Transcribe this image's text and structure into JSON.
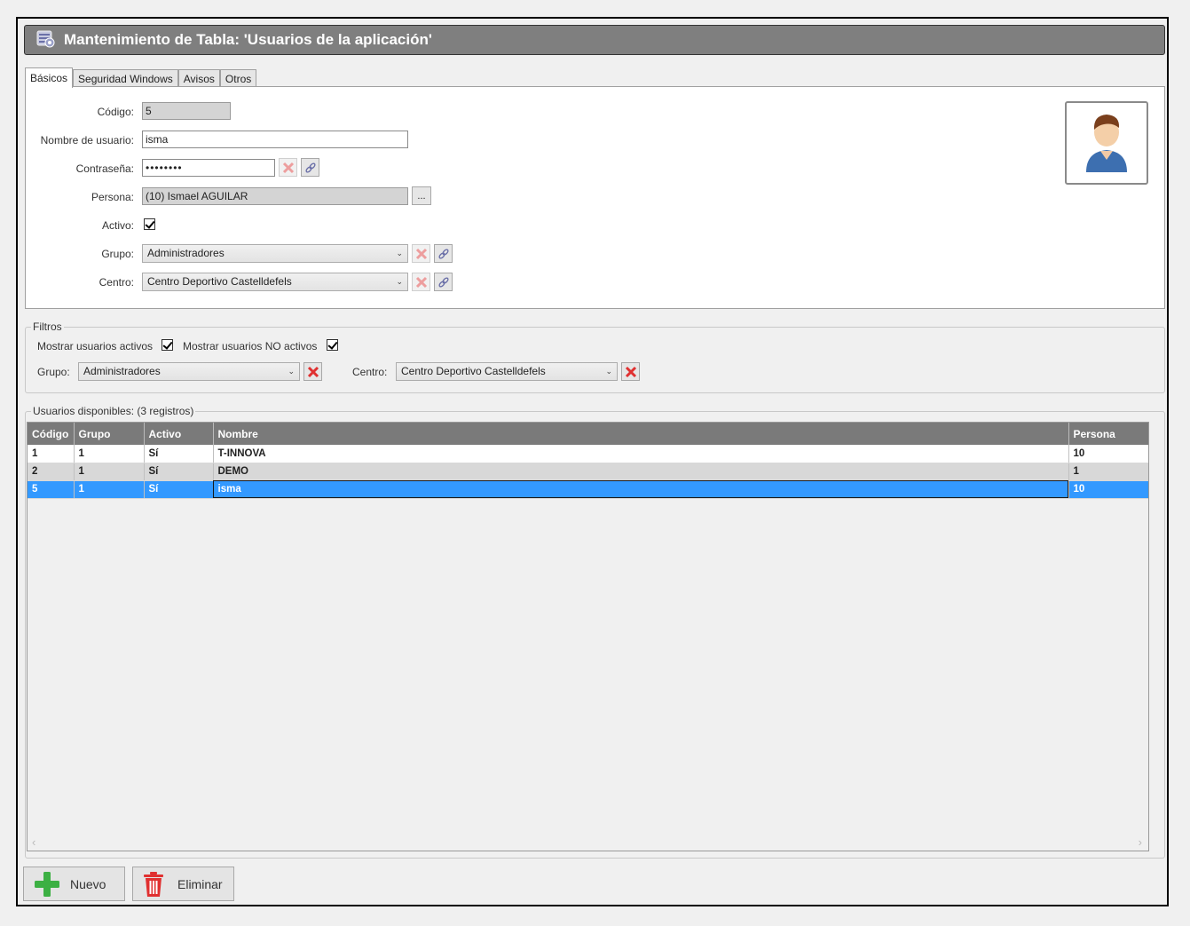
{
  "window": {
    "title": "Mantenimiento de Tabla: 'Usuarios de la aplicación'"
  },
  "tabs": [
    {
      "label": "Básicos",
      "active": true
    },
    {
      "label": "Seguridad Windows"
    },
    {
      "label": "Avisos"
    },
    {
      "label": "Otros"
    }
  ],
  "form": {
    "codigo_label": "Código:",
    "codigo_value": "5",
    "nombre_label": "Nombre de usuario:",
    "nombre_value": "isma",
    "password_label": "Contraseña:",
    "password_value": "••••••••",
    "persona_label": "Persona:",
    "persona_value": "(10) Ismael AGUILAR",
    "persona_button": "...",
    "activo_label": "Activo:",
    "activo_checked": true,
    "grupo_label": "Grupo:",
    "grupo_value": "Administradores",
    "centro_label": "Centro:",
    "centro_value": "Centro Deportivo Castelldefels"
  },
  "filters": {
    "legend": "Filtros",
    "show_active_label": "Mostrar usuarios activos",
    "show_inactive_label": "Mostrar usuarios NO activos",
    "grupo_label": "Grupo:",
    "grupo_value": "Administradores",
    "centro_label": "Centro:",
    "centro_value": "Centro Deportivo Castelldefels"
  },
  "users": {
    "legend": "Usuarios disponibles:  (3 registros)",
    "columns": [
      "Código",
      "Grupo",
      "Activo",
      "Nombre",
      "Persona"
    ],
    "rows": [
      {
        "codigo": "1",
        "grupo": "1",
        "activo": "Sí",
        "nombre": "T-INNOVA",
        "persona": "10"
      },
      {
        "codigo": "2",
        "grupo": "1",
        "activo": "Sí",
        "nombre": "DEMO",
        "persona": "1"
      },
      {
        "codigo": "5",
        "grupo": "1",
        "activo": "Sí",
        "nombre": "isma",
        "persona": "10"
      }
    ],
    "selected_row": 2
  },
  "actions": {
    "new_label": "Nuevo",
    "delete_label": "Eliminar"
  },
  "colors": {
    "title_bg": "#7f7f7f",
    "selection": "#3399ff",
    "grid_header": "#7a7a7a",
    "delete_red": "#e03030",
    "add_green": "#3cb043"
  },
  "icons": [
    "table-settings-icon",
    "user-avatar-icon",
    "clear-x-icon",
    "link-icon",
    "plus-icon",
    "trash-icon"
  ]
}
